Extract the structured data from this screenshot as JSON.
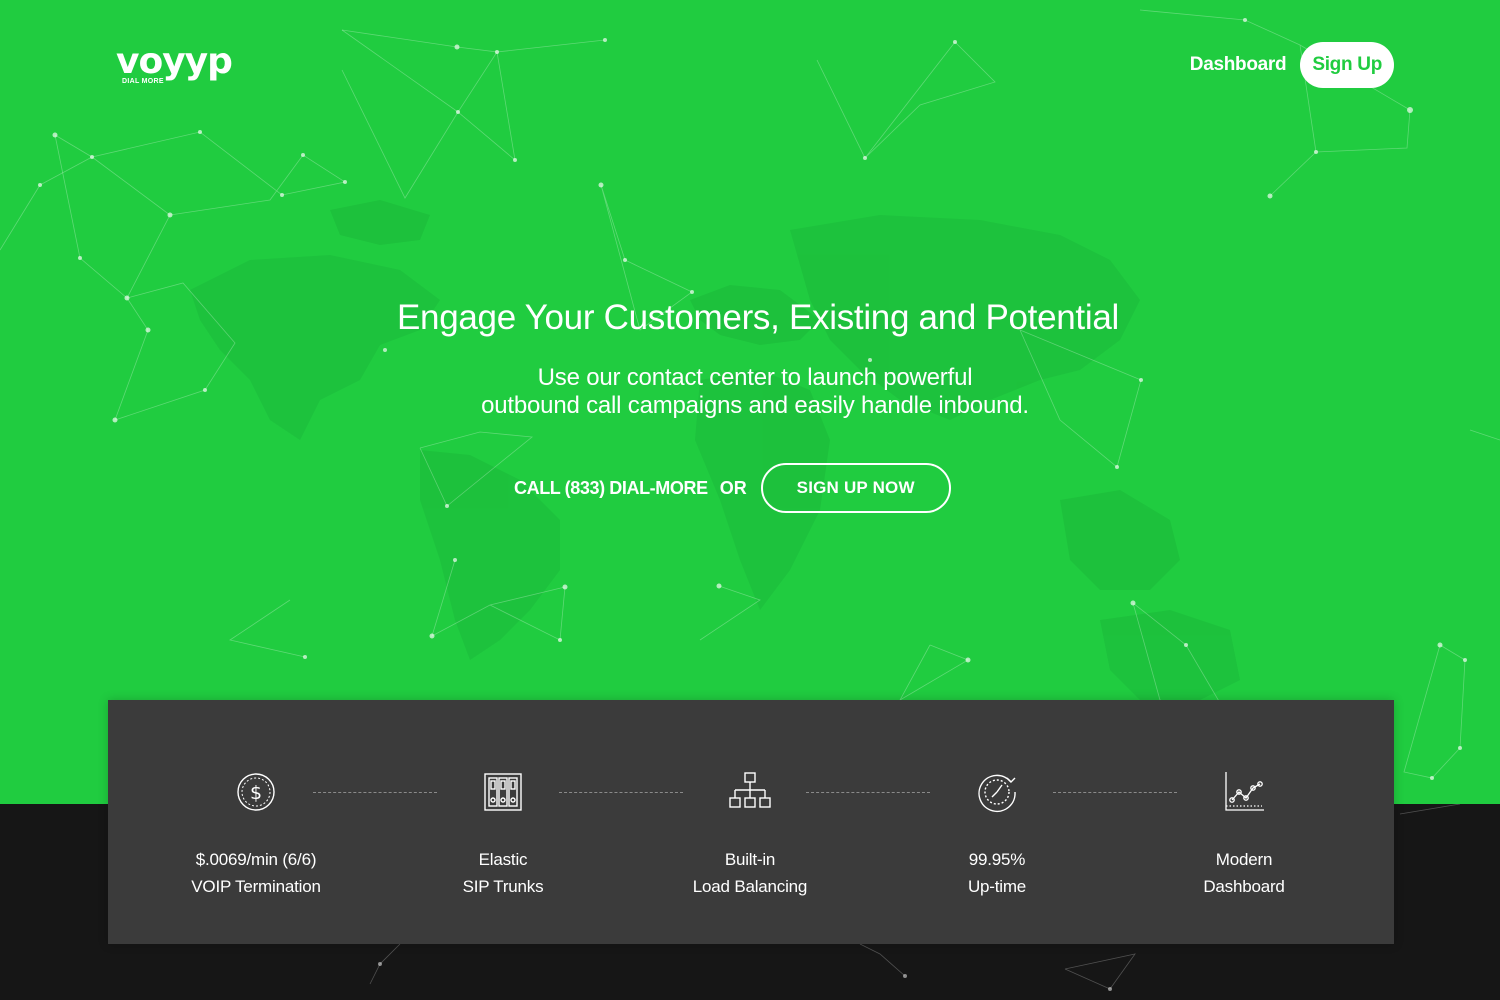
{
  "brand": {
    "name": "voyyp",
    "tagline": "DIAL MORE"
  },
  "nav": {
    "dashboard": "Dashboard",
    "signup": "Sign Up"
  },
  "hero": {
    "headline": "Engage Your Customers, Existing and Potential",
    "sub_line1": "Use our contact center to launch powerful",
    "sub_line2": "outbound call campaigns and easily handle inbound.",
    "call_text": "CALL (833) DIAL-MORE",
    "or_text": "OR",
    "cta_button": "SIGN UP NOW"
  },
  "features": [
    {
      "icon": "dollar-coin-icon",
      "line1": "$.0069/min (6/6)",
      "line2": "VOIP Termination"
    },
    {
      "icon": "server-rack-icon",
      "line1": "Elastic",
      "line2": "SIP Trunks"
    },
    {
      "icon": "network-hierarchy-icon",
      "line1": "Built-in",
      "line2": "Load Balancing"
    },
    {
      "icon": "stopwatch-icon",
      "line1": "99.95%",
      "line2": "Up-time"
    },
    {
      "icon": "line-chart-icon",
      "line1": "Modern",
      "line2": "Dashboard"
    }
  ],
  "colors": {
    "accent": "#20cc40",
    "panel": "#3b3b3b",
    "footer": "#161616"
  }
}
